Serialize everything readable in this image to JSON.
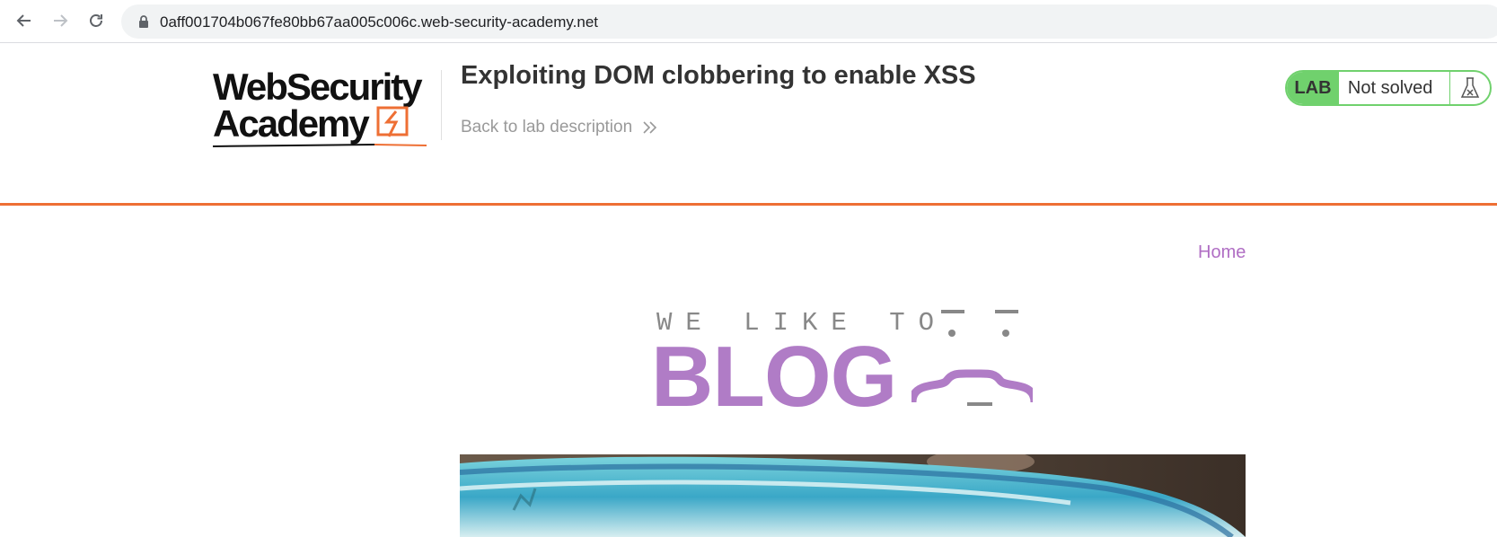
{
  "browser": {
    "url": "0aff001704b067fe80bb67aa005c006c.web-security-academy.net"
  },
  "lab_header": {
    "logo_line1": "WebSecurity",
    "logo_line2": "Academy",
    "title": "Exploiting DOM clobbering to enable XSS",
    "back_link": "Back to lab description",
    "status_badge": "LAB",
    "status_text": "Not solved",
    "accent_color": "#ee6f34",
    "status_color": "#70d16d"
  },
  "blog": {
    "nav_home": "Home",
    "banner_top": "WE LIKE TO",
    "banner_main": "BLOG",
    "brand_color": "#b07cc6"
  }
}
